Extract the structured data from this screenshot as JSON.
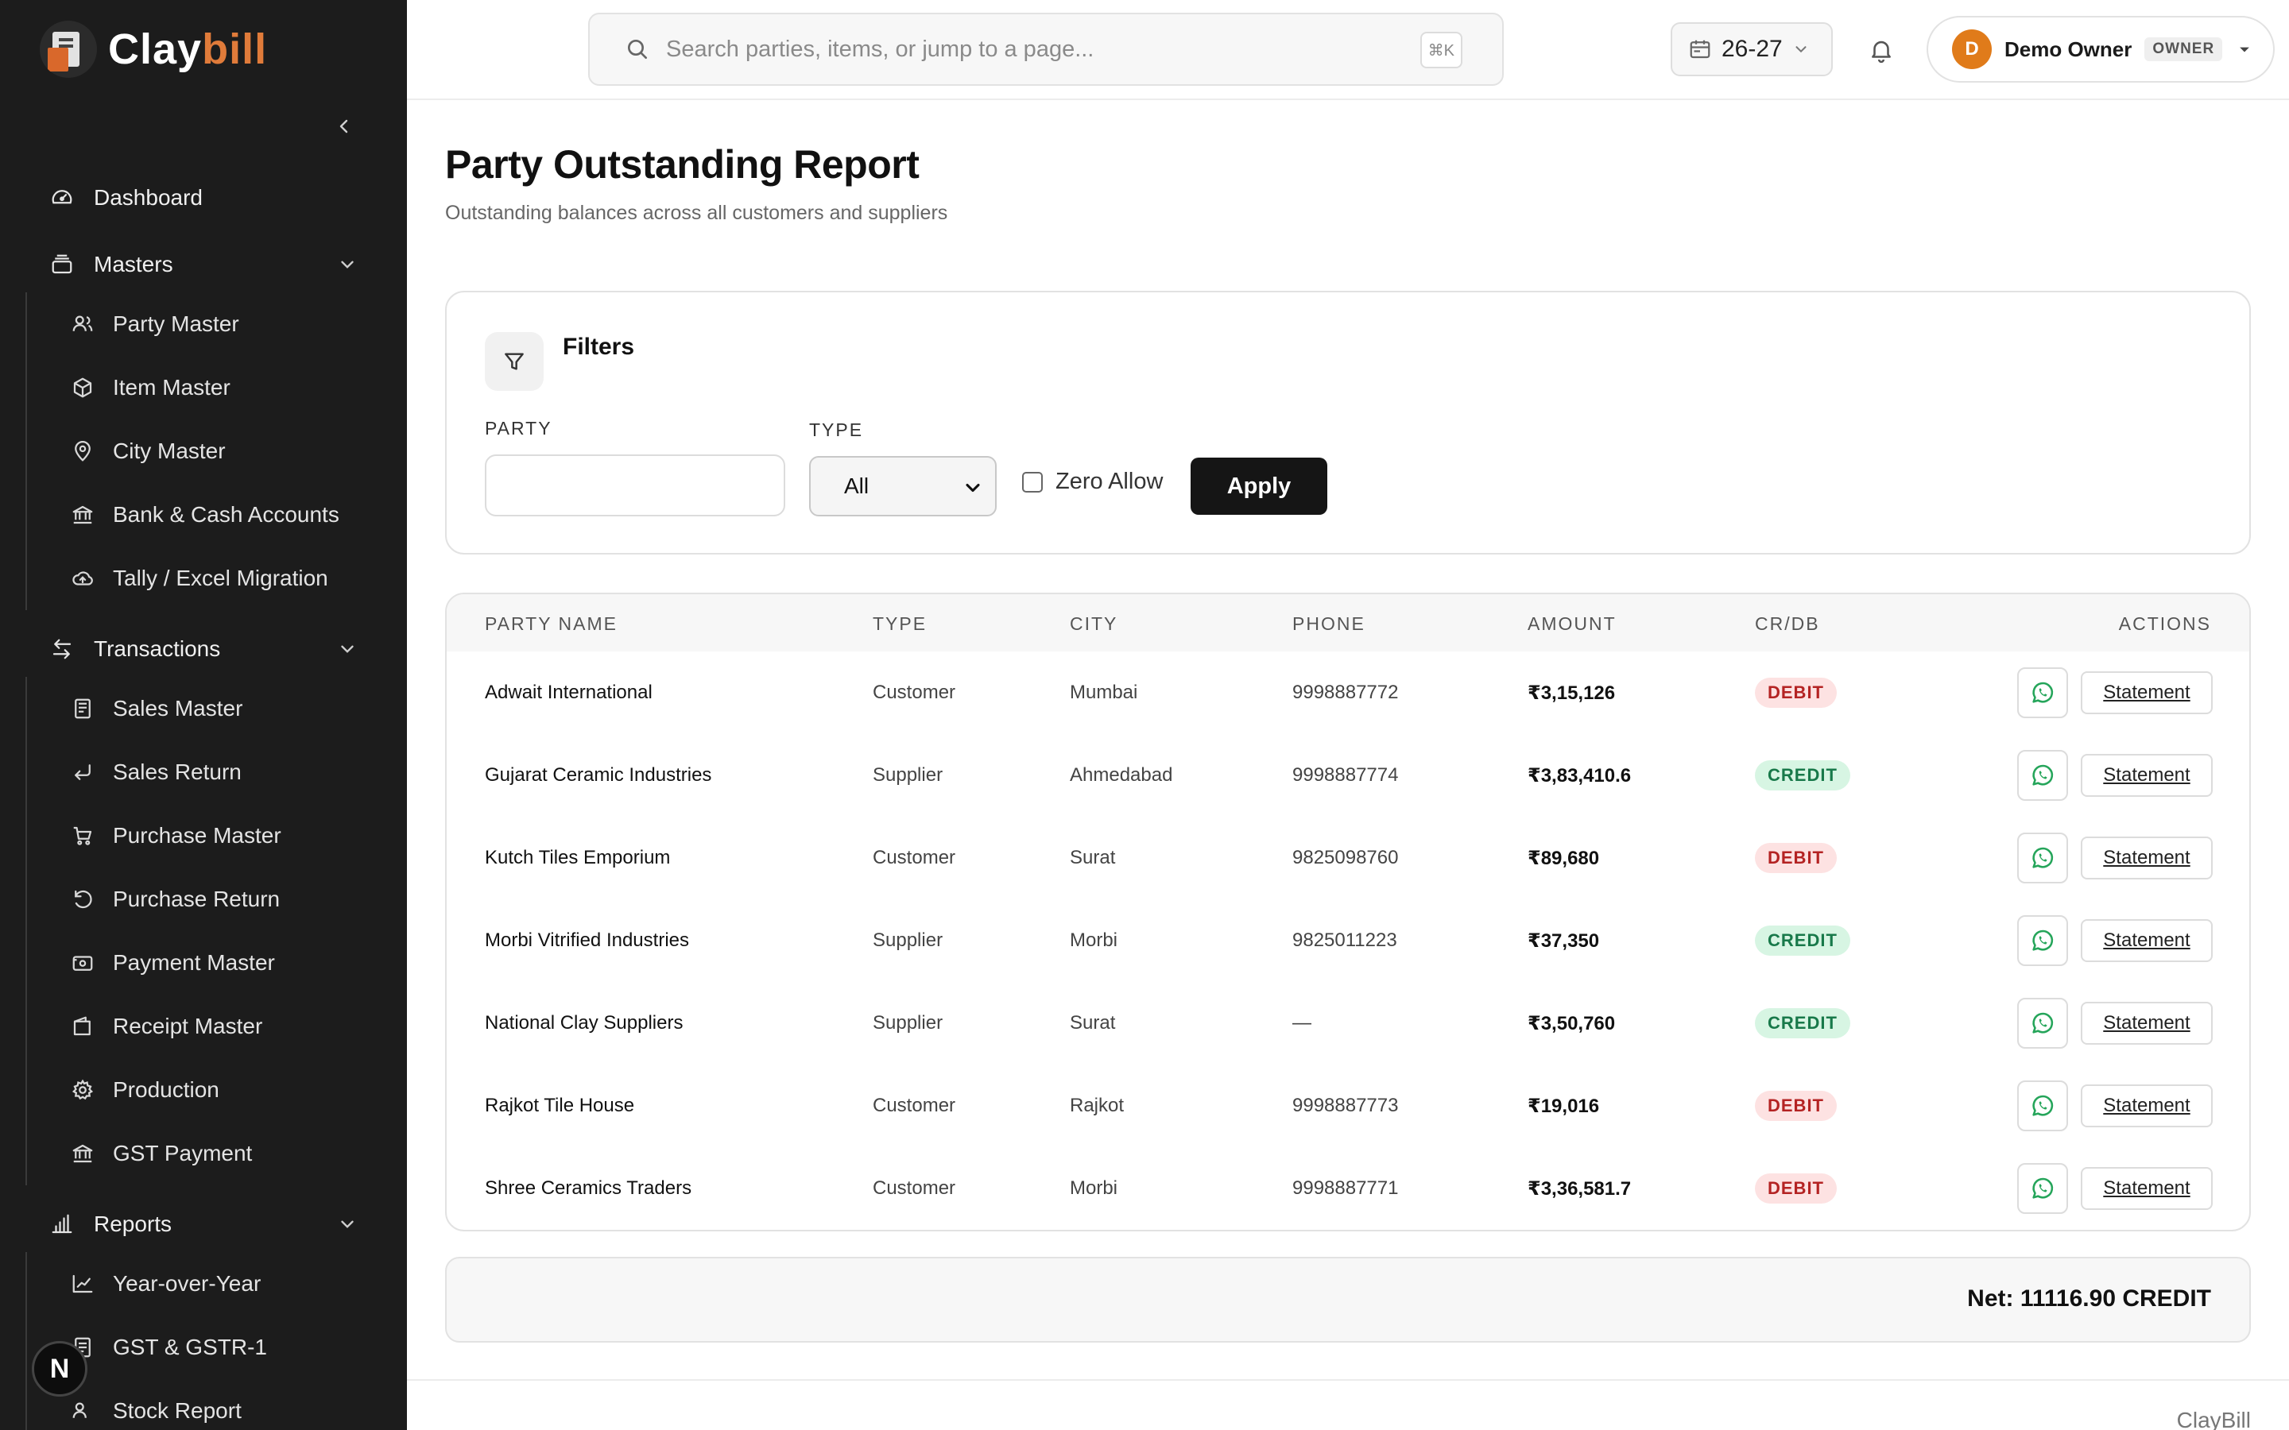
{
  "app": {
    "logo_prefix": "Clay",
    "logo_suffix": "bill",
    "footer_brand": "ClayBill"
  },
  "sidebar": {
    "dashboard": "Dashboard",
    "masters": {
      "label": "Masters",
      "items": [
        "Party Master",
        "Item Master",
        "City Master",
        "Bank & Cash Accounts",
        "Tally / Excel Migration"
      ]
    },
    "transactions": {
      "label": "Transactions",
      "items": [
        "Sales Master",
        "Sales Return",
        "Purchase Master",
        "Purchase Return",
        "Payment Master",
        "Receipt Master",
        "Production",
        "GST Payment"
      ]
    },
    "reports": {
      "label": "Reports",
      "items": [
        "Year-over-Year",
        "GST & GSTR-1",
        "Stock Report"
      ]
    },
    "badge": "N"
  },
  "topbar": {
    "search_placeholder": "Search parties, items, or jump to a page...",
    "search_shortcut": "⌘K",
    "fiscal_year": "26-27",
    "user_initial": "D",
    "user_name": "Demo Owner",
    "user_role": "OWNER"
  },
  "page": {
    "title": "Party Outstanding Report",
    "subtitle": "Outstanding balances across all customers and suppliers"
  },
  "filters": {
    "title": "Filters",
    "party_label": "PARTY",
    "party_value": "",
    "type_label": "TYPE",
    "type_value": "All",
    "zero_allow_label": "Zero Allow",
    "zero_allow_checked": false,
    "apply_label": "Apply"
  },
  "table": {
    "headers": [
      "PARTY NAME",
      "TYPE",
      "CITY",
      "PHONE",
      "AMOUNT",
      "CR/DB",
      "ACTIONS"
    ],
    "action_label": "Statement",
    "rows": [
      {
        "name": "Adwait International",
        "type": "Customer",
        "city": "Mumbai",
        "phone": "9998887772",
        "amount": "₹3,15,126",
        "crdb": "DEBIT"
      },
      {
        "name": "Gujarat Ceramic Industries",
        "type": "Supplier",
        "city": "Ahmedabad",
        "phone": "9998887774",
        "amount": "₹3,83,410.6",
        "crdb": "CREDIT"
      },
      {
        "name": "Kutch Tiles Emporium",
        "type": "Customer",
        "city": "Surat",
        "phone": "9825098760",
        "amount": "₹89,680",
        "crdb": "DEBIT"
      },
      {
        "name": "Morbi Vitrified Industries",
        "type": "Supplier",
        "city": "Morbi",
        "phone": "9825011223",
        "amount": "₹37,350",
        "crdb": "CREDIT"
      },
      {
        "name": "National Clay Suppliers",
        "type": "Supplier",
        "city": "Surat",
        "phone": "—",
        "amount": "₹3,50,760",
        "crdb": "CREDIT"
      },
      {
        "name": "Rajkot Tile House",
        "type": "Customer",
        "city": "Rajkot",
        "phone": "9998887773",
        "amount": "₹19,016",
        "crdb": "DEBIT"
      },
      {
        "name": "Shree Ceramics Traders",
        "type": "Customer",
        "city": "Morbi",
        "phone": "9998887771",
        "amount": "₹3,36,581.7",
        "crdb": "DEBIT"
      }
    ]
  },
  "summary": {
    "net": "Net: 11116.90 CREDIT"
  },
  "colors": {
    "sidebar_bg": "#1c1c1c",
    "accent": "#e07b3a",
    "debit_text": "#b42323",
    "credit_text": "#18794a",
    "whatsapp": "#25a55a"
  }
}
